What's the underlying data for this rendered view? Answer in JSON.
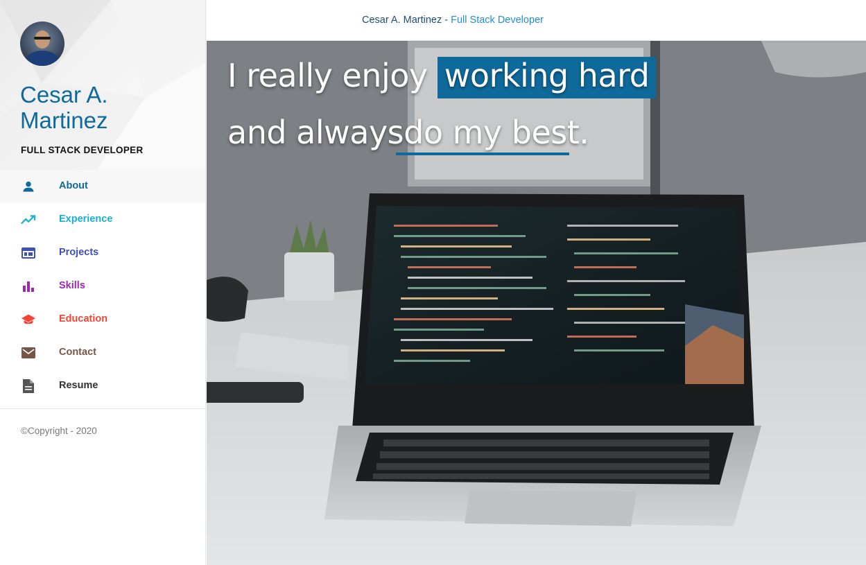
{
  "sidebar": {
    "name": "Cesar A. Martinez",
    "role": "FULL STACK DEVELOPER",
    "avatar_icon": "user-photo",
    "nav": [
      {
        "label": "About",
        "icon": "person-icon",
        "color": "#0f6a9c"
      },
      {
        "label": "Experience",
        "icon": "trending-up-icon",
        "color": "#17b0d0"
      },
      {
        "label": "Projects",
        "icon": "web-window-icon",
        "color": "#3f51b5"
      },
      {
        "label": "Skills",
        "icon": "bar-chart-icon",
        "color": "#9c27b0"
      },
      {
        "label": "Education",
        "icon": "graduation-cap-icon",
        "color": "#f44336"
      },
      {
        "label": "Contact",
        "icon": "mail-icon",
        "color": "#795548"
      },
      {
        "label": "Resume",
        "icon": "document-icon",
        "color": "#333333"
      }
    ],
    "copyright": "©Copyright - 2020"
  },
  "topbar": {
    "name": "Cesar A. Martinez",
    "separator": " - ",
    "role": "Full Stack Developer"
  },
  "hero": {
    "line1_prefix": "I really enjoy ",
    "line1_highlight": "working hard",
    "line2": "and alwaysdo my best.",
    "accent_color": "#0f6a9c"
  }
}
